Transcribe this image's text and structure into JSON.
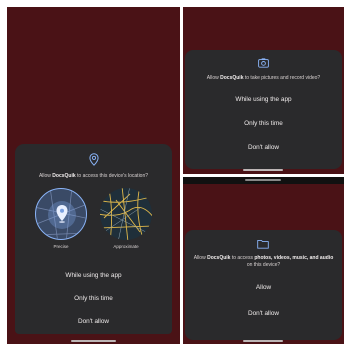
{
  "location": {
    "prompt_pre": "Allow ",
    "app_name": "DocsQuik",
    "prompt_post": " to access this device's location?",
    "precise_label": "Precise",
    "approximate_label": "Approximate",
    "options": [
      "While using the app",
      "Only this time",
      "Don't allow"
    ]
  },
  "camera": {
    "prompt_pre": "Allow ",
    "app_name": "DocsQuik",
    "prompt_post": " to take pictures and record video?",
    "options": [
      "While using the app",
      "Only this time",
      "Don't allow"
    ]
  },
  "media": {
    "prompt_pre": "Allow ",
    "app_name": "DocsQuik",
    "prompt_mid": " to access ",
    "prompt_bold": "photos, videos, music, and audio",
    "prompt_post": " on this device?",
    "options": [
      "Allow",
      "Don't allow"
    ]
  },
  "colors": {
    "background": "#4a1216",
    "sheet": "#2a2a2c",
    "accent": "#8ab4f8"
  },
  "icons": [
    "location-pin-icon",
    "camera-icon",
    "folder-icon"
  ]
}
